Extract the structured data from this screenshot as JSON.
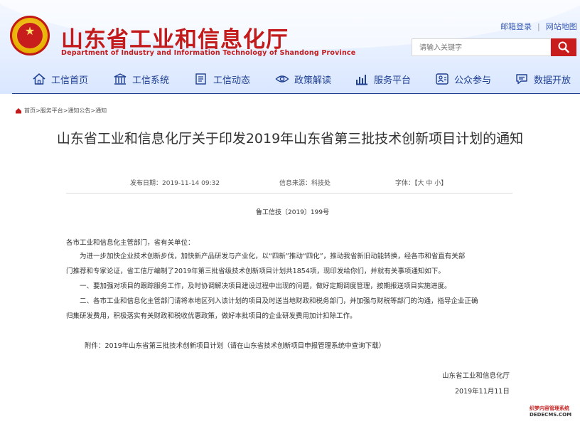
{
  "header": {
    "title": "山东省工业和信息化厅",
    "subtitle": "Department of Industry and Information Technology of Shandong Province",
    "top_links": [
      "邮箱登录",
      "网站地图"
    ],
    "search_placeholder": "请输入关键字"
  },
  "nav": {
    "items": [
      {
        "label": "工信首页",
        "icon": "home-icon"
      },
      {
        "label": "工信系统",
        "icon": "building-icon"
      },
      {
        "label": "工信动态",
        "icon": "document-icon"
      },
      {
        "label": "政策解读",
        "icon": "eye-icon"
      },
      {
        "label": "服务平台",
        "icon": "chart-icon"
      },
      {
        "label": "公众参与",
        "icon": "people-icon"
      },
      {
        "label": "数据开放",
        "icon": "chat-icon"
      }
    ]
  },
  "breadcrumb": "首页>服务平台>通知公告>通知",
  "article": {
    "title": "山东省工业和信息化厅关于印发2019年山东省第三批技术创新项目计划的通知",
    "publish_date": "发布日期：2019-11-14 09:32",
    "source": "信息来源：科技处",
    "font_label": "字体：",
    "font_sizes": "【大 中 小】",
    "doc_number": "鲁工信技〔2019〕199号",
    "salutation": "各市工业和信息化主管部门，省有关单位：",
    "para1_line1": "为进一步加快企业技术创新步伐，加快新产品研发与产业化，以“四新”推动“四化”，推动我省新旧动能转换，经各市和省直有关部",
    "para1_line2": "门推荐和专家论证，省工信厅编制了2019年第三批省级技术创新项目计划共1854项，现印发给你们，并就有关事项通知如下。",
    "para2": "一、要加强对项目的跟踪服务工作，及时协调解决项目建设过程中出现的问题，做好定期调度管理，按期报送项目实施进度。",
    "para3_line1": "二、各市工业和信息化主管部门请将本地区列入该计划的项目及时送当地财政和税务部门，并加强与财税等部门的沟通，指导企业正确",
    "para3_line2": "归集研发费用，积极落实有关财政和税收优惠政策，做好本批项目的企业研发费用加计扣除工作。",
    "attachment": "附件：2019年山东省第三批技术创新项目计划（请在山东省技术创新项目申报管理系统中查询下载）",
    "signature_org": "山东省工业和信息化厅",
    "signature_date": "2019年11月11日"
  },
  "watermark": {
    "line1": "织梦内容管理系统",
    "line2": "DEDECMS.COM"
  },
  "colors": {
    "brand_red": "#c31b1b",
    "nav_blue": "#1e3f92",
    "link_blue": "#3b5db8"
  }
}
